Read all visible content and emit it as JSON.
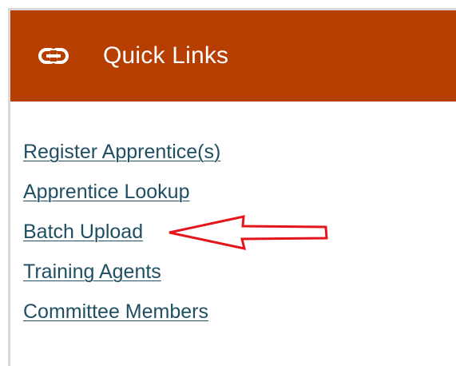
{
  "quick_links": {
    "header": {
      "icon": "link-icon",
      "title": "Quick Links",
      "background_color": "#b63e00"
    },
    "items": [
      {
        "label": "Register Apprentice(s)"
      },
      {
        "label": "Apprentice Lookup"
      },
      {
        "label": "Batch Upload"
      },
      {
        "label": "Training Agents"
      },
      {
        "label": "Committee Members"
      }
    ],
    "link_color": "#1f4f63",
    "annotation": {
      "icon": "red-arrow-icon",
      "target": "Batch Upload",
      "color": "#e3161c"
    }
  }
}
